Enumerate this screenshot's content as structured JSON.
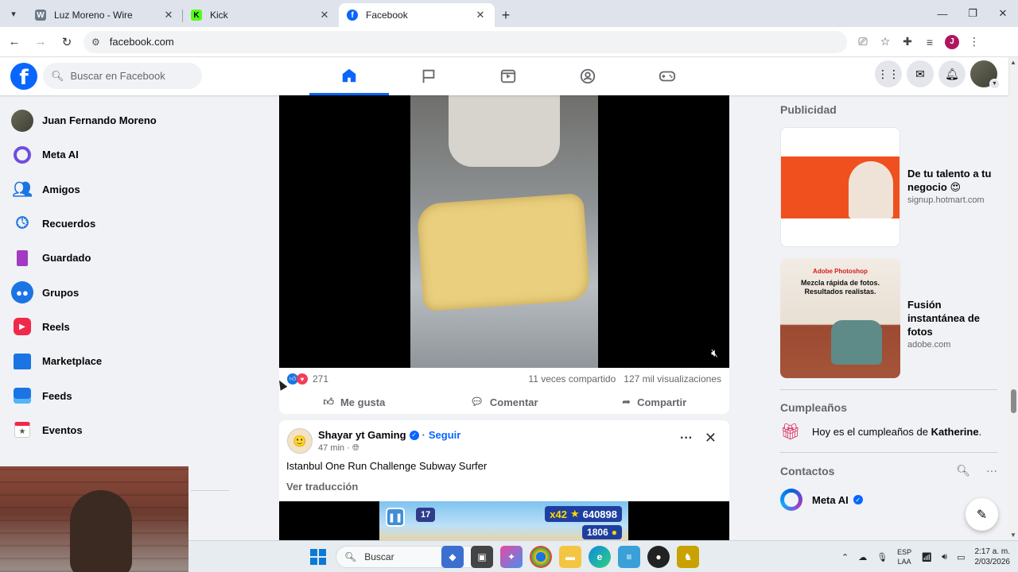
{
  "browser": {
    "tabs": [
      {
        "title": "Luz Moreno - Wire",
        "favicon": "W",
        "favicon_color": "#6c7a89"
      },
      {
        "title": "Kick",
        "favicon": "K",
        "favicon_color": "#53fc18"
      },
      {
        "title": "Facebook",
        "favicon": "f",
        "favicon_color": "#0866ff"
      }
    ],
    "url": "facebook.com",
    "profile_initial": "J"
  },
  "fb": {
    "search_placeholder": "Buscar en Facebook",
    "logo": "f"
  },
  "sidebar": {
    "items": [
      {
        "label": "Juan Fernando Moreno",
        "icon": "user-avatar-icon"
      },
      {
        "label": "Meta AI",
        "icon": "meta-ai-icon"
      },
      {
        "label": "Amigos",
        "icon": "friends-icon"
      },
      {
        "label": "Recuerdos",
        "icon": "memories-clock-icon"
      },
      {
        "label": "Guardado",
        "icon": "saved-bookmark-icon"
      },
      {
        "label": "Grupos",
        "icon": "groups-icon"
      },
      {
        "label": "Reels",
        "icon": "reels-icon"
      },
      {
        "label": "Marketplace",
        "icon": "marketplace-icon"
      },
      {
        "label": "Feeds",
        "icon": "feeds-icon"
      },
      {
        "label": "Eventos",
        "icon": "events-icon"
      }
    ]
  },
  "post1": {
    "reaction_count": "271",
    "shares": "11 veces compartido",
    "views": "127 mil visualizaciones",
    "actions": {
      "like": "Me gusta",
      "comment": "Comentar",
      "share": "Compartir"
    }
  },
  "post2": {
    "author": "Shayar yt Gaming",
    "follow": "Seguir",
    "time": "47 min",
    "text": "Istanbul One Run Challenge Subway Surfer",
    "translate": "Ver traducción",
    "game": {
      "badge": "17",
      "multiplier": "x42",
      "score": "640898",
      "coins": "1806"
    }
  },
  "rightcol": {
    "ads_heading": "Publicidad",
    "ads": [
      {
        "title": "De tu talento a tu negocio 😍",
        "url": "signup.hotmart.com"
      },
      {
        "title": "Fusión instantánea de fotos",
        "url": "adobe.com",
        "brand": "Adobe Photoshop",
        "tagline1": "Mezcla rápida de fotos.",
        "tagline2": "Resultados realistas."
      }
    ],
    "birthdays_heading": "Cumpleaños",
    "birthday_prefix": "Hoy es el cumpleaños de ",
    "birthday_name": "Katherine",
    "birthday_suffix": ".",
    "contacts_heading": "Contactos",
    "contacts": [
      {
        "name": "Meta AI"
      }
    ]
  },
  "taskbar": {
    "search": "Buscar",
    "lang_top": "ESP",
    "lang_bottom": "LAA",
    "time": "2:17 a. m.",
    "date": "2/03/2026"
  }
}
